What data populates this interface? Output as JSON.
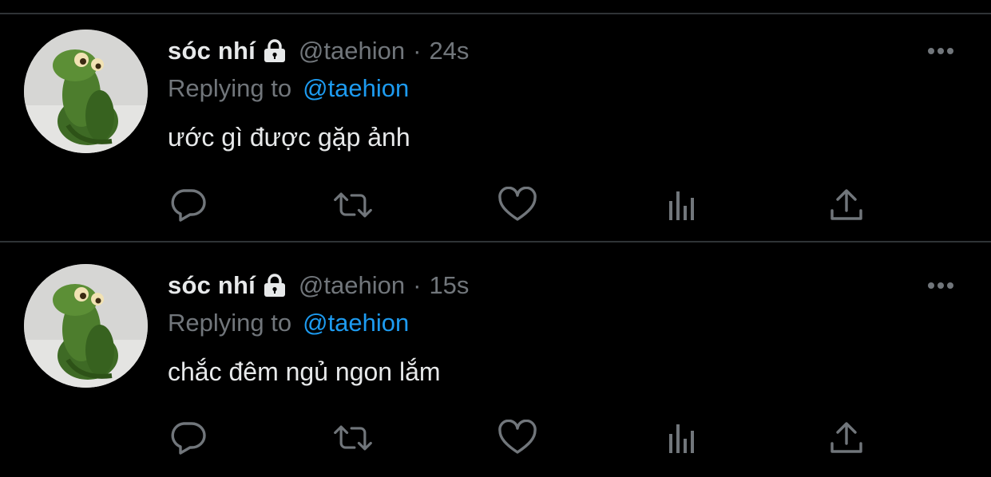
{
  "colors": {
    "background": "#000000",
    "divider": "#2f3336",
    "text": "#e7e9ea",
    "secondary": "#71767b",
    "link": "#1d9bf0",
    "icon": "#71767b"
  },
  "tweets": [
    {
      "display_name": "sóc nhí",
      "protected_icon": "lock-icon",
      "handle": "@taehion",
      "separator": "·",
      "time": "24s",
      "replying_label": "Replying to",
      "replying_to": "@taehion",
      "text": "ước gì được gặp ảnh",
      "avatar_icon": "green-frog-plush-avatar",
      "more_icon": "more-icon",
      "action_icons": [
        "reply-icon",
        "retweet-icon",
        "like-icon",
        "views-icon",
        "share-icon"
      ]
    },
    {
      "display_name": "sóc nhí",
      "protected_icon": "lock-icon",
      "handle": "@taehion",
      "separator": "·",
      "time": "15s",
      "replying_label": "Replying to",
      "replying_to": "@taehion",
      "text": "chắc đêm ngủ ngon lắm",
      "avatar_icon": "green-frog-plush-avatar",
      "more_icon": "more-icon",
      "action_icons": [
        "reply-icon",
        "retweet-icon",
        "like-icon",
        "views-icon",
        "share-icon"
      ]
    }
  ]
}
